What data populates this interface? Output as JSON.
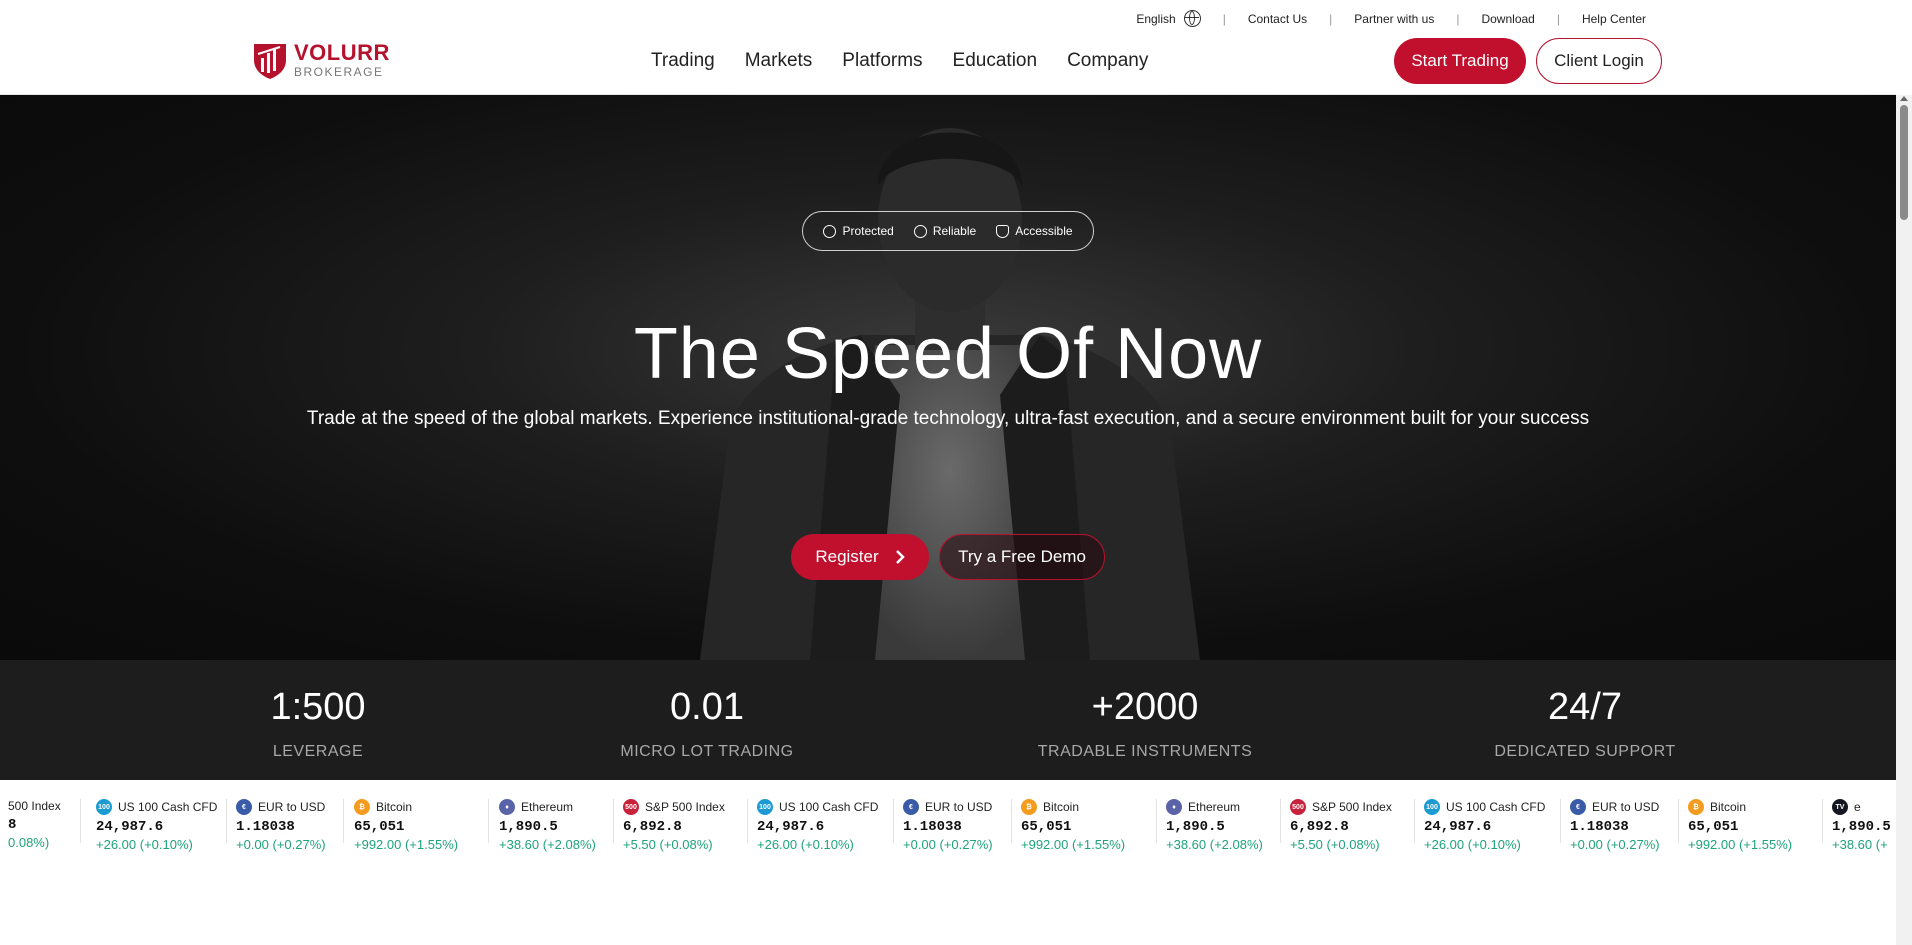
{
  "topbar": {
    "language": "English",
    "links": [
      "Contact Us",
      "Partner with us",
      "Download",
      "Help Center"
    ]
  },
  "logo": {
    "name": "VOLURR",
    "tagline": "BROKERAGE",
    "brand_color": "#b5122e"
  },
  "nav": {
    "items": [
      "Trading",
      "Markets",
      "Platforms",
      "Education",
      "Company"
    ]
  },
  "header_buttons": {
    "start": "Start Trading",
    "login": "Client Login"
  },
  "hero": {
    "badges": [
      "Protected",
      "Reliable",
      "Accessible"
    ],
    "title": "The Speed Of Now",
    "subtitle": "Trade at the speed of the global markets. Experience institutional-grade technology, ultra-fast execution, and a secure environment built for your success",
    "register": "Register",
    "demo": "Try a Free Demo"
  },
  "stats": [
    {
      "value": "1:500",
      "label": "LEVERAGE"
    },
    {
      "value": "0.01",
      "label": "MICRO LOT TRADING"
    },
    {
      "value": "+2000",
      "label": "TRADABLE INSTRUMENTS"
    },
    {
      "value": "24/7",
      "label": "DEDICATED SUPPORT"
    }
  ],
  "ticker": {
    "items": [
      {
        "name": "500 Index",
        "icon": "",
        "color": "",
        "price": "8",
        "change": "0.08%)"
      },
      {
        "name": "US 100 Cash CFD",
        "icon": "100",
        "color": "#1b9bd1",
        "price": "24,987.6",
        "change": "+26.00 (+0.10%)"
      },
      {
        "name": "EUR to USD",
        "icon": "€",
        "color": "#3a5ba8",
        "price": "1.18038",
        "change": "+0.00 (+0.27%)"
      },
      {
        "name": "Bitcoin",
        "icon": "₿",
        "color": "#f39c1f",
        "price": "65,051",
        "change": "+992.00 (+1.55%)"
      },
      {
        "name": "Ethereum",
        "icon": "♦",
        "color": "#5b63a8",
        "price": "1,890.5",
        "change": "+38.60 (+2.08%)"
      },
      {
        "name": "S&P 500 Index",
        "icon": "500",
        "color": "#c8213b",
        "price": "6,892.8",
        "change": "+5.50 (+0.08%)"
      },
      {
        "name": "US 100 Cash CFD",
        "icon": "100",
        "color": "#1b9bd1",
        "price": "24,987.6",
        "change": "+26.00 (+0.10%)"
      },
      {
        "name": "EUR to USD",
        "icon": "€",
        "color": "#3a5ba8",
        "price": "1.18038",
        "change": "+0.00 (+0.27%)"
      },
      {
        "name": "Bitcoin",
        "icon": "₿",
        "color": "#f39c1f",
        "price": "65,051",
        "change": "+992.00 (+1.55%)"
      },
      {
        "name": "Ethereum",
        "icon": "♦",
        "color": "#5b63a8",
        "price": "1,890.5",
        "change": "+38.60 (+2.08%)"
      },
      {
        "name": "S&P 500 Index",
        "icon": "500",
        "color": "#c8213b",
        "price": "6,892.8",
        "change": "+5.50 (+0.08%)"
      },
      {
        "name": "US 100 Cash CFD",
        "icon": "100",
        "color": "#1b9bd1",
        "price": "24,987.6",
        "change": "+26.00 (+0.10%)"
      },
      {
        "name": "EUR to USD",
        "icon": "€",
        "color": "#3a5ba8",
        "price": "1.18038",
        "change": "+0.00 (+0.27%)"
      },
      {
        "name": "Bitcoin",
        "icon": "₿",
        "color": "#f39c1f",
        "price": "65,051",
        "change": "+992.00 (+1.55%)"
      },
      {
        "name": "e",
        "icon": "TV",
        "color": "#131722",
        "price": "1,890.5",
        "change": "+38.60 (+"
      }
    ]
  },
  "colors": {
    "accent": "#c0102e",
    "positive": "#1fa37a",
    "hero_bg": "#111111",
    "stats_bg": "#1d1d1d"
  }
}
